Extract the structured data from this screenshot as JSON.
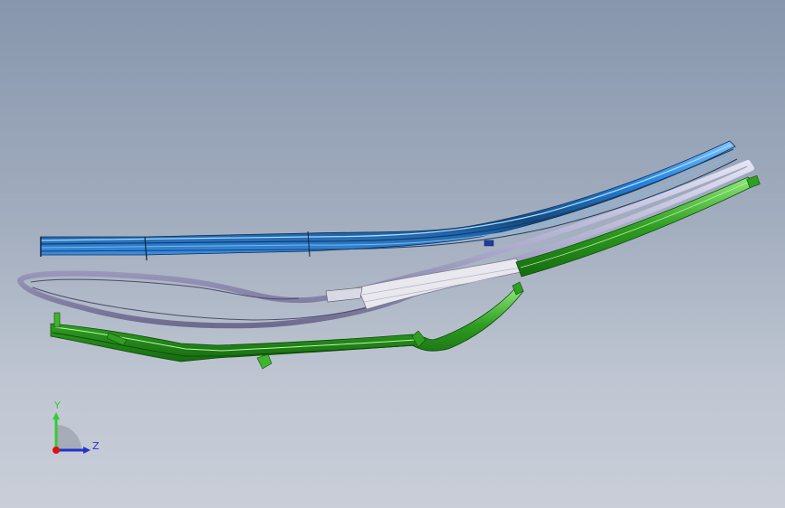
{
  "viewport": {
    "background_top": "#8796ad",
    "background_bottom": "#c9ced8"
  },
  "parts": [
    {
      "name": "upper-rail-assembly",
      "color": "#2a7fd4"
    },
    {
      "name": "middle-loop-frame",
      "color": "#b9b8d6"
    },
    {
      "name": "lower-rail-assembly",
      "color": "#3fb52e"
    }
  ],
  "triad": {
    "y_label": "Y",
    "z_label": "Z",
    "y_color": "#33cc33",
    "z_color": "#2233cc",
    "x_color": "#dd1111"
  }
}
